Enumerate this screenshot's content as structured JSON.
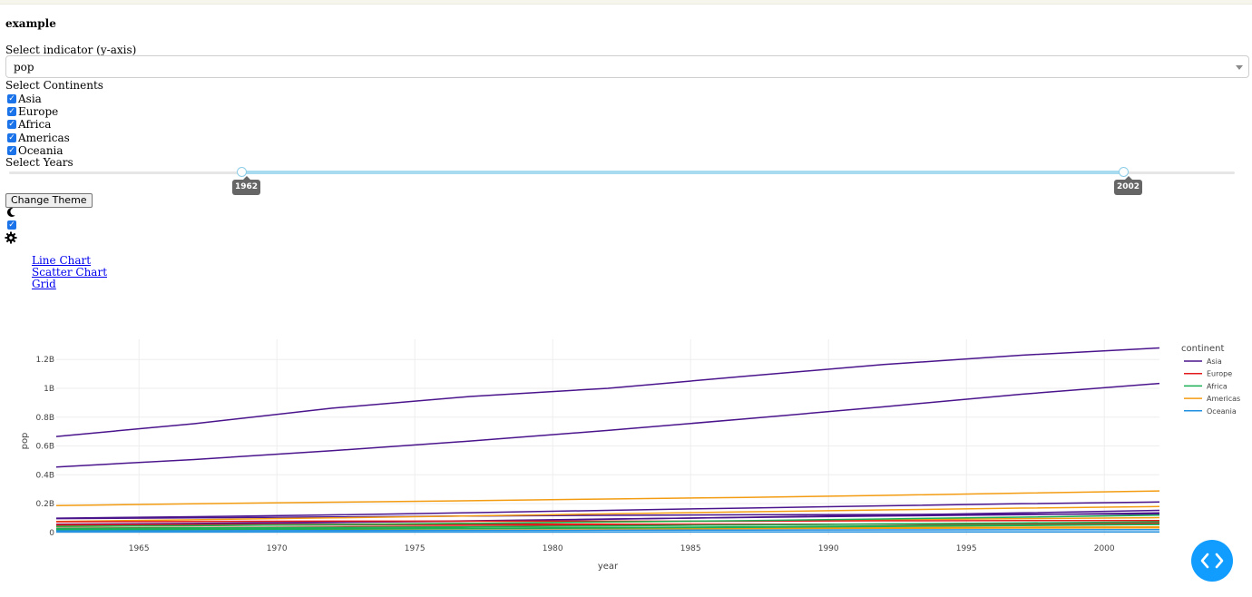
{
  "app": {
    "title": "example"
  },
  "indicator": {
    "label": "Select indicator (y-axis)",
    "value": "pop"
  },
  "continents": {
    "label": "Select Continents",
    "options": [
      {
        "label": "Asia",
        "checked": true
      },
      {
        "label": "Europe",
        "checked": true
      },
      {
        "label": "Africa",
        "checked": true
      },
      {
        "label": "Americas",
        "checked": true
      },
      {
        "label": "Oceania",
        "checked": true
      }
    ]
  },
  "years": {
    "label": "Select Years",
    "min_label": "1962",
    "max_label": "2002"
  },
  "theme": {
    "button_label": "Change Theme",
    "toggle_checked": true,
    "dark_icon": "moon-icon",
    "light_icon": "gear-icon"
  },
  "nav": {
    "links": [
      "Line Chart",
      "Scatter Chart",
      "Grid"
    ]
  },
  "colors": {
    "Asia": "#4a148c",
    "Europe": "#e31a1c",
    "Africa": "#1aaf54",
    "Americas": "#f39c12",
    "Oceania": "#1f8fe0"
  },
  "chart_data": {
    "type": "line",
    "xlabel": "year",
    "ylabel": "pop",
    "x": [
      1962,
      1967,
      1972,
      1977,
      1982,
      1987,
      1992,
      1997,
      2002
    ],
    "xticks": [
      1965,
      1970,
      1975,
      1980,
      1985,
      1990,
      1995,
      2000
    ],
    "yticks": [
      0,
      200000000,
      400000000,
      600000000,
      800000000,
      1000000000,
      1200000000
    ],
    "ytick_labels": [
      "0",
      "0.2B",
      "0.4B",
      "0.6B",
      "0.8B",
      "1B",
      "1.2B"
    ],
    "xlim": [
      1962,
      2002
    ],
    "ylim": [
      -20000000,
      1340000000
    ],
    "grid": true,
    "legend": {
      "title": "continent",
      "placement": "right",
      "entries": [
        "Asia",
        "Europe",
        "Africa",
        "Americas",
        "Oceania"
      ]
    },
    "series": [
      {
        "group": "Asia",
        "values": [
          665770000,
          754550000,
          862030000,
          943455000,
          1000281000,
          1084035000,
          1164970000,
          1230075000,
          1280400000
        ]
      },
      {
        "group": "Asia",
        "values": [
          454000000,
          506000000,
          567000000,
          634000000,
          708000000,
          788000000,
          872000000,
          959000000,
          1034173000
        ]
      },
      {
        "group": "Asia",
        "values": [
          99028000,
          109343000,
          121282000,
          136725000,
          153344000,
          169276000,
          184816000,
          199278000,
          211060000
        ]
      },
      {
        "group": "Asia",
        "values": [
          95832000,
          100825000,
          107188000,
          113872000,
          118454974,
          122091325,
          124329269,
          125956499,
          127065841
        ]
      },
      {
        "group": "Asia",
        "values": [
          56839289,
          62821884,
          70759295,
          80428306,
          93074406,
          103764241,
          113704579,
          123315288,
          135656790
        ]
      },
      {
        "group": "Asia",
        "values": [
          53100671,
          60641899,
          69325921,
          78152686,
          91462088,
          105186881,
          120065004,
          135564834,
          153403524
        ]
      },
      {
        "group": "Americas",
        "values": [
          186538000,
          198712000,
          209896000,
          220239000,
          232187835,
          242803533,
          256894189,
          272911760,
          287675526
        ]
      },
      {
        "group": "Americas",
        "values": [
          76039390,
          88049823,
          100840058,
          114313951,
          128962939,
          142938076,
          155975974,
          168546719,
          179914212
        ]
      },
      {
        "group": "Americas",
        "values": [
          41121485,
          47995559,
          55984294,
          63759976,
          71640904,
          80122492,
          88111030,
          95895146,
          102479927
        ]
      },
      {
        "group": "Americas",
        "values": [
          21283783,
          22934225,
          24779799,
          26983828,
          29341374,
          31620918,
          33958947,
          36203463,
          38331121
        ]
      },
      {
        "group": "Americas",
        "values": [
          18985849,
          20819767,
          22284500,
          23796400,
          25201900,
          26549700,
          28523502,
          30305843,
          31902268
        ]
      },
      {
        "group": "Europe",
        "values": [
          73739117,
          76368453,
          78717088,
          78160773,
          78335266,
          77718298,
          80597764,
          82011073,
          82350671
        ]
      },
      {
        "group": "Europe",
        "values": [
          29788695,
          33411317,
          37492953,
          42404033,
          47328791,
          52881328,
          58179144,
          63047647,
          67308928
        ]
      },
      {
        "group": "Europe",
        "values": [
          53292000,
          54959000,
          56079000,
          56179000,
          56339704,
          56981620,
          57866349,
          58808266,
          59488698
        ]
      },
      {
        "group": "Europe",
        "values": [
          53165019,
          54066000,
          54433565,
          55630100,
          56314067,
          56981620,
          57374179,
          58190070,
          59193589
        ]
      },
      {
        "group": "Europe",
        "values": [
          47124000,
          49569000,
          51732000,
          53165019,
          54433565,
          55630100,
          57374179,
          58623428,
          59925035
        ]
      },
      {
        "group": "Europe",
        "values": [
          50843200,
          52667100,
          54365564,
          56059245,
          56535636,
          56729703,
          56840847,
          57479469,
          57926999
        ]
      },
      {
        "group": "Africa",
        "values": [
          41871351,
          47287752,
          53740085,
          62209173,
          73039376,
          81551520,
          93364244,
          106207839,
          119901274
        ]
      },
      {
        "group": "Africa",
        "values": [
          28173309,
          31681188,
          34807417,
          38783863,
          45681811,
          52799062,
          59402198,
          66134291,
          73312559
        ]
      },
      {
        "group": "Africa",
        "values": [
          20997321,
          23993335,
          26973810,
          29918790,
          33885353,
          38783863,
          45681811,
          51745021,
          55379852
        ]
      },
      {
        "group": "Africa",
        "values": [
          17486434,
          19941073,
          23007669,
          26480870,
          30646495,
          35481645,
          41672143,
          47798986,
          55379852
        ]
      },
      {
        "group": "Oceania",
        "values": [
          10794968,
          11872264,
          13177000,
          14074100,
          15184200,
          16257249,
          17481977,
          18565243,
          19546792
        ]
      },
      {
        "group": "Oceania",
        "values": [
          2488550,
          2728150,
          2929100,
          3164900,
          3210650,
          3317166,
          3437674,
          3676187,
          3908037
        ]
      }
    ]
  }
}
